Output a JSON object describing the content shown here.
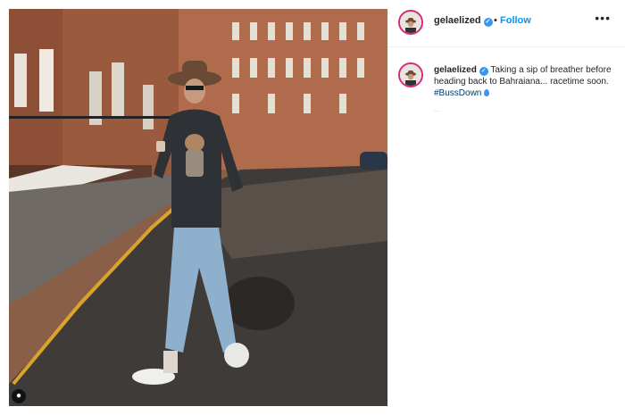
{
  "post": {
    "username": "gelaelized",
    "verified": true,
    "follow_label": "Follow",
    "separator": "•",
    "more_icon": "more-options-icon",
    "caption": {
      "text": "Taking a sip of breather before heading back to Bahraiana... racetime soon.",
      "hashtag": "#BussDown",
      "emoji": "droplet-icon"
    },
    "timestamp": "..."
  },
  "colors": {
    "accent": "#0095f6",
    "verified": "#3897f0",
    "hashtag": "#00376b",
    "text": "#262626",
    "avatar_ring": "#d62976"
  },
  "photo": {
    "subject": "man-walking-street",
    "user_tag_icon": "person-tag-icon"
  }
}
